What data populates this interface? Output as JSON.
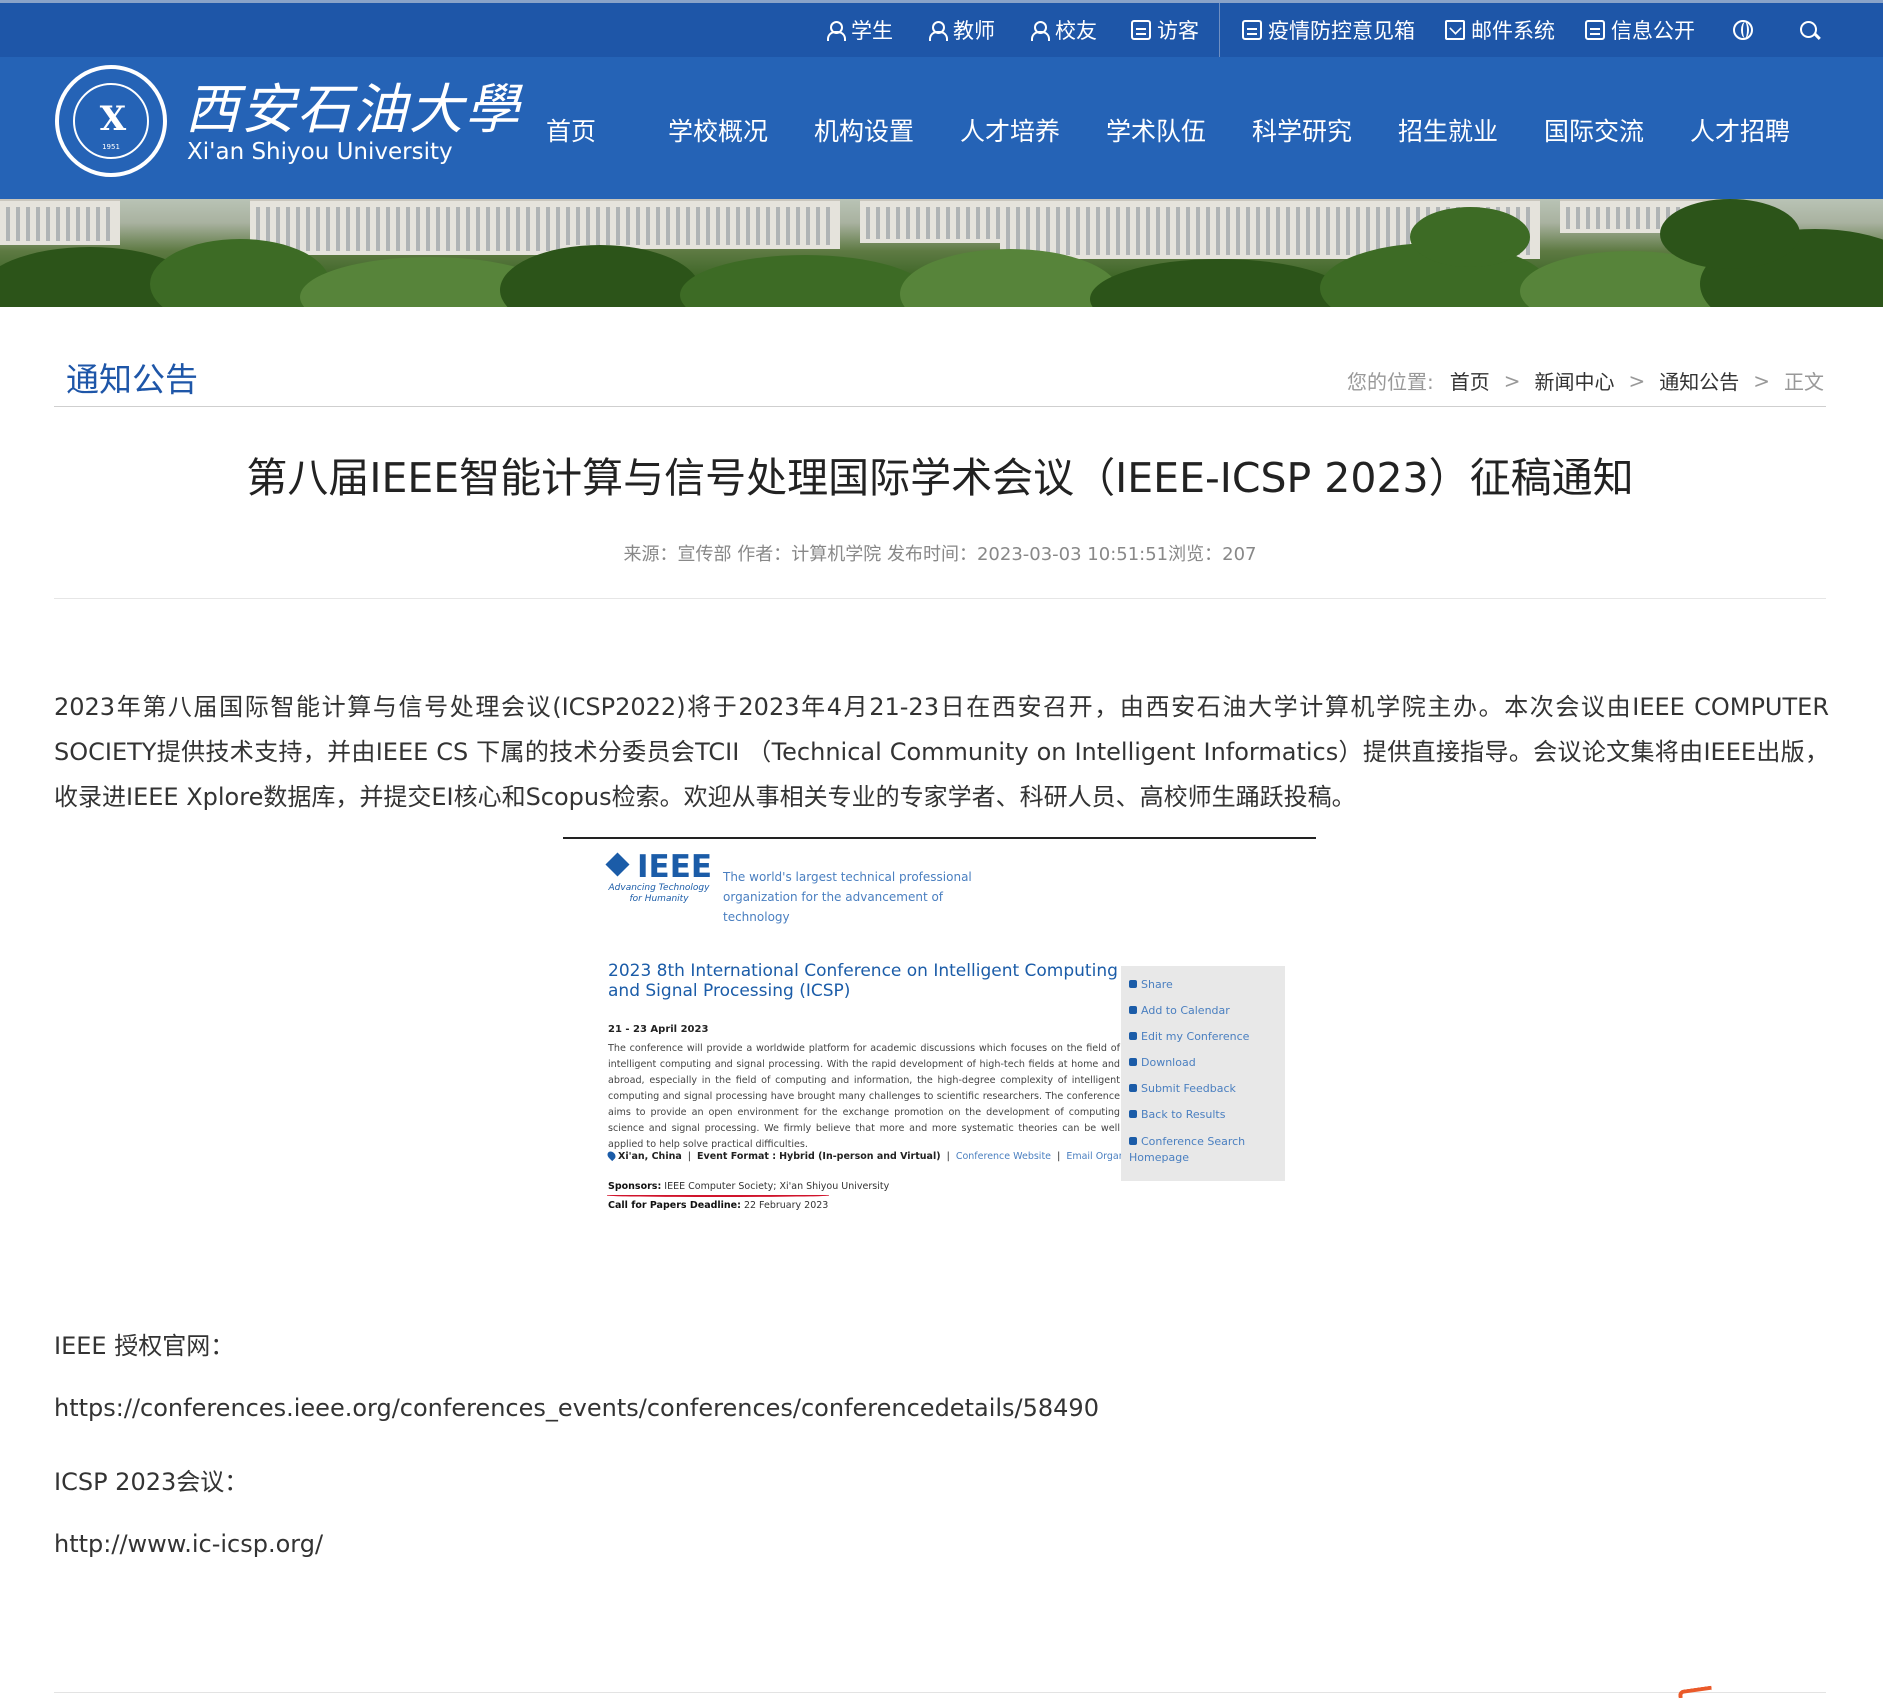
{
  "topbar": {
    "links": [
      {
        "label": "学生",
        "icon": "user-icon"
      },
      {
        "label": "教师",
        "icon": "teacher-icon"
      },
      {
        "label": "校友",
        "icon": "alumni-icon"
      },
      {
        "label": "访客",
        "icon": "visitor-icon"
      },
      {
        "label": "疫情防控意见箱",
        "icon": "message-box-icon"
      },
      {
        "label": "邮件系统",
        "icon": "mail-icon"
      },
      {
        "label": "信息公开",
        "icon": "info-icon"
      }
    ],
    "language_icon": "globe-icon",
    "search_icon": "search-icon"
  },
  "header": {
    "logo_cn": "西安石油大學",
    "logo_en": "Xi'an Shiyou University",
    "emblem_year": "1951",
    "nav": [
      "首页",
      "学校概况",
      "机构设置",
      "人才培养",
      "学术队伍",
      "科学研究",
      "招生就业",
      "国际交流",
      "人才招聘"
    ]
  },
  "section": {
    "title": "通知公告",
    "breadcrumb_prefix": "您的位置:",
    "breadcrumb": [
      "首页",
      "新闻中心",
      "通知公告"
    ],
    "breadcrumb_current": "正文",
    "breadcrumb_separator": ">"
  },
  "article": {
    "title": "第八届IEEE智能计算与信号处理国际学术会议（IEEE-ICSP 2023）征稿通知",
    "meta": "来源：宣传部 作者：计算机学院 发布时间：2023-03-03 10:51:51浏览：207",
    "body": "2023年第八届国际智能计算与信号处理会议(ICSP2022)将于2023年4月21-23日在西安召开，由西安石油大学计算机学院主办。本次会议由IEEE COMPUTER SOCIETY提供技术支持，并由IEEE CS 下属的技术分委员会TCII （Technical Community on Intelligent Informatics）提供直接指导。会议论文集将由IEEE出版，收录进IEEE Xplore数据库，并提交EI核心和Scopus检索。欢迎从事相关专业的专家学者、科研人员、高校师生踊跃投稿。",
    "embedded_image": {
      "ieee_word": "IEEE",
      "ieee_subtitle": "Advancing Technology for Humanity",
      "ieee_tagline": "The world's largest technical professional organization for the advancement of technology",
      "conference_title": "2023 8th International Conference on Intelligent Computing and Signal Processing (ICSP)",
      "dates": "21 - 23 April 2023",
      "description": "The conference will provide a worldwide platform for academic discussions which focuses on the field of intelligent computing and signal processing. With the rapid development of high-tech fields at home and abroad, especially in the field of computing and information, the high-degree complexity of intelligent computing and signal processing have brought many challenges to scientific researchers. The conference aims to provide an open environment for the exchange promotion on the development of computing science and signal processing. We firmly believe that more and more systematic theories can be well applied to help solve practical difficulties.",
      "location": "Xi'an, China",
      "event_format_label": "Event Format :",
      "event_format": "Hybrid (In-person and Virtual)",
      "conference_website": "Conference Website",
      "email_organizer": "Email Organizer",
      "sponsors_label": "Sponsors:",
      "sponsors": "IEEE Computer Society; Xi'an Shiyou University",
      "cfp_label": "Call for Papers Deadline:",
      "cfp": "22 February 2023",
      "side_actions": [
        "Share",
        "Add to Calendar",
        "Edit my Conference",
        "Download",
        "Submit Feedback",
        "Back to Results",
        "Conference Search Homepage"
      ]
    },
    "ieee_label": "IEEE 授权官网：",
    "ieee_url": "https://conferences.ieee.org/conferences_events/conferences/conferencedetails/58490",
    "icsp_label": "ICSP 2023会议：",
    "icsp_url": "http://www.ic-icsp.org/"
  },
  "colors": {
    "topbar": "#1e56a8",
    "header": "#2563b6",
    "accent_title": "#1e56a8",
    "ieee_blue": "#1b5ca8",
    "underline_red": "#d0142c"
  }
}
